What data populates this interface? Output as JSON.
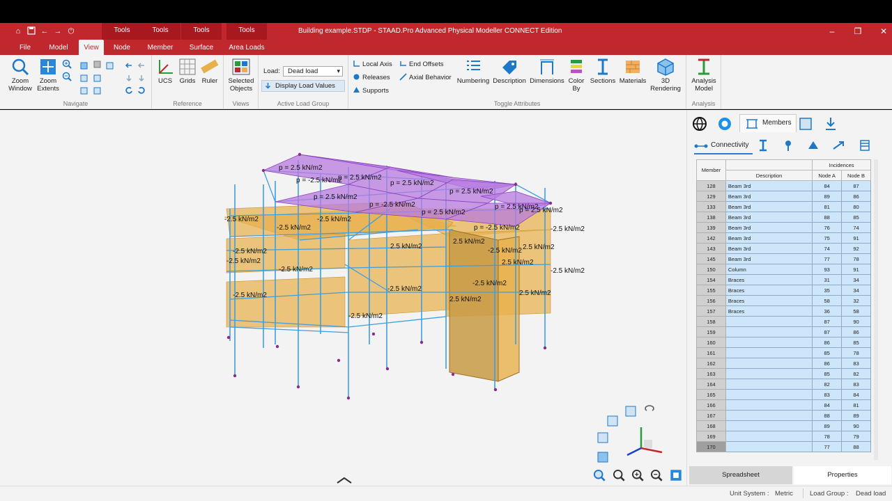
{
  "colors": {
    "brand": "#c0282d",
    "accent": "#2d7bd6",
    "member_blue": "#3d9ee0",
    "slab_orange": "#e8b04b",
    "roof_purple": "#b87be0"
  },
  "window": {
    "title": "Building example.STDP - STAAD.Pro Advanced Physical Modeller CONNECT Edition",
    "context_tabs": [
      "Tools",
      "Tools",
      "Tools",
      "Tools"
    ],
    "minimize": "–",
    "maximize": "❐",
    "close": "✕"
  },
  "tabs": [
    "File",
    "Model",
    "View",
    "Node",
    "Member",
    "Surface",
    "Area Loads"
  ],
  "ribbon": {
    "navigate": {
      "label": "Navigate",
      "zoom_window": "Zoom\nWindow",
      "zoom_extents": "Zoom\nExtents"
    },
    "reference": {
      "label": "Reference",
      "ucs": "UCS",
      "grids": "Grids",
      "ruler": "Ruler"
    },
    "views": {
      "label": "Views",
      "selected_objects": "Selected\nObjects"
    },
    "active_load_group": {
      "label": "Active Load Group",
      "load_label": "Load:",
      "load_value": "Dead load",
      "display_load_values": "Display Load Values"
    },
    "toggle_attributes": {
      "label": "Toggle Attributes",
      "local_axis": "Local Axis",
      "end_offsets": "End Offsets",
      "releases": "Releases",
      "axial_behavior": "Axial Behavior",
      "supports": "Supports",
      "numbering": "Numbering",
      "description": "Description",
      "dimensions": "Dimensions",
      "color_by": "Color\nBy",
      "sections": "Sections",
      "materials": "Materials",
      "rendering_3d": "3D\nRendering"
    },
    "analysis": {
      "label": "Analysis",
      "analysis_model": "Analysis\nModel"
    }
  },
  "model": {
    "roof_loads": [
      "p = 2.5 kN/m2",
      "p = -2.5 kN/m2",
      "p = 2.5 kN/m2",
      "p = 2.5 kN/m2",
      "p = 2.5 kN/m2",
      "p = 2.5 kN/m2",
      "p = -2.5 kN/m2",
      "p = 2.5 kN/m2",
      "p = 2.5 kN/m2",
      "p = -2.5 kN/m2",
      "p = 2.5 kN/m2"
    ],
    "floor_loads": [
      "-2.5 kN/m2",
      "-2.5 kN/m2",
      "-2.5 kN/m2",
      "-2.5 kN/m2",
      "-2.5 kN/m2",
      "2.5 kN/m2",
      "-2.5 kN/m2",
      "-2.5 kN/m2",
      "2.5 kN/m2",
      "-2.5 kN/m2",
      "-2.5 kN/m2",
      "2.5 kN/m2",
      "2.5 kN/m2",
      "-2.5 kN/m2",
      "-2.5 kN/m2",
      "-2.5 kN/m2",
      "2.5 kN/m2",
      "-2.5 kN/m2",
      "2.5 kN/m2"
    ]
  },
  "panel": {
    "tabs": {
      "members": "Members"
    },
    "subtab_connectivity": "Connectivity",
    "columns": {
      "member": "Member",
      "incidences": "Incidences",
      "description": "Description",
      "node_a": "Node A",
      "node_b": "Node B"
    },
    "rows": [
      {
        "member": "128",
        "description": "Beam 3rd",
        "node_a": "84",
        "node_b": "87"
      },
      {
        "member": "129",
        "description": "Beam 3rd",
        "node_a": "89",
        "node_b": "86"
      },
      {
        "member": "133",
        "description": "Beam 3rd",
        "node_a": "81",
        "node_b": "80"
      },
      {
        "member": "138",
        "description": "Beam 3rd",
        "node_a": "88",
        "node_b": "85"
      },
      {
        "member": "139",
        "description": "Beam 3rd",
        "node_a": "76",
        "node_b": "74"
      },
      {
        "member": "142",
        "description": "Beam 3rd",
        "node_a": "75",
        "node_b": "91"
      },
      {
        "member": "143",
        "description": "Beam 3rd",
        "node_a": "74",
        "node_b": "92"
      },
      {
        "member": "145",
        "description": "Beam 3rd",
        "node_a": "77",
        "node_b": "78"
      },
      {
        "member": "150",
        "description": "Column",
        "node_a": "93",
        "node_b": "91"
      },
      {
        "member": "154",
        "description": "Braces",
        "node_a": "31",
        "node_b": "34"
      },
      {
        "member": "155",
        "description": "Braces",
        "node_a": "35",
        "node_b": "34"
      },
      {
        "member": "156",
        "description": "Braces",
        "node_a": "58",
        "node_b": "32"
      },
      {
        "member": "157",
        "description": "Braces",
        "node_a": "36",
        "node_b": "58"
      },
      {
        "member": "158",
        "description": "",
        "node_a": "87",
        "node_b": "90"
      },
      {
        "member": "159",
        "description": "",
        "node_a": "87",
        "node_b": "86"
      },
      {
        "member": "160",
        "description": "",
        "node_a": "86",
        "node_b": "85"
      },
      {
        "member": "161",
        "description": "",
        "node_a": "85",
        "node_b": "78"
      },
      {
        "member": "162",
        "description": "",
        "node_a": "86",
        "node_b": "83"
      },
      {
        "member": "163",
        "description": "",
        "node_a": "85",
        "node_b": "82"
      },
      {
        "member": "164",
        "description": "",
        "node_a": "82",
        "node_b": "83"
      },
      {
        "member": "165",
        "description": "",
        "node_a": "83",
        "node_b": "84"
      },
      {
        "member": "166",
        "description": "",
        "node_a": "84",
        "node_b": "81"
      },
      {
        "member": "167",
        "description": "",
        "node_a": "88",
        "node_b": "89"
      },
      {
        "member": "168",
        "description": "",
        "node_a": "89",
        "node_b": "90"
      },
      {
        "member": "169",
        "description": "",
        "node_a": "78",
        "node_b": "79"
      },
      {
        "member": "170",
        "description": "",
        "node_a": "77",
        "node_b": "88"
      }
    ],
    "selected_row": 25,
    "spreadsheet_button": "Spreadsheet",
    "properties_button": "Properties"
  },
  "status": {
    "unit_system_label": "Unit System :",
    "unit_system_value": "Metric",
    "load_group_label": "Load Group :",
    "load_group_value": "Dead load"
  }
}
